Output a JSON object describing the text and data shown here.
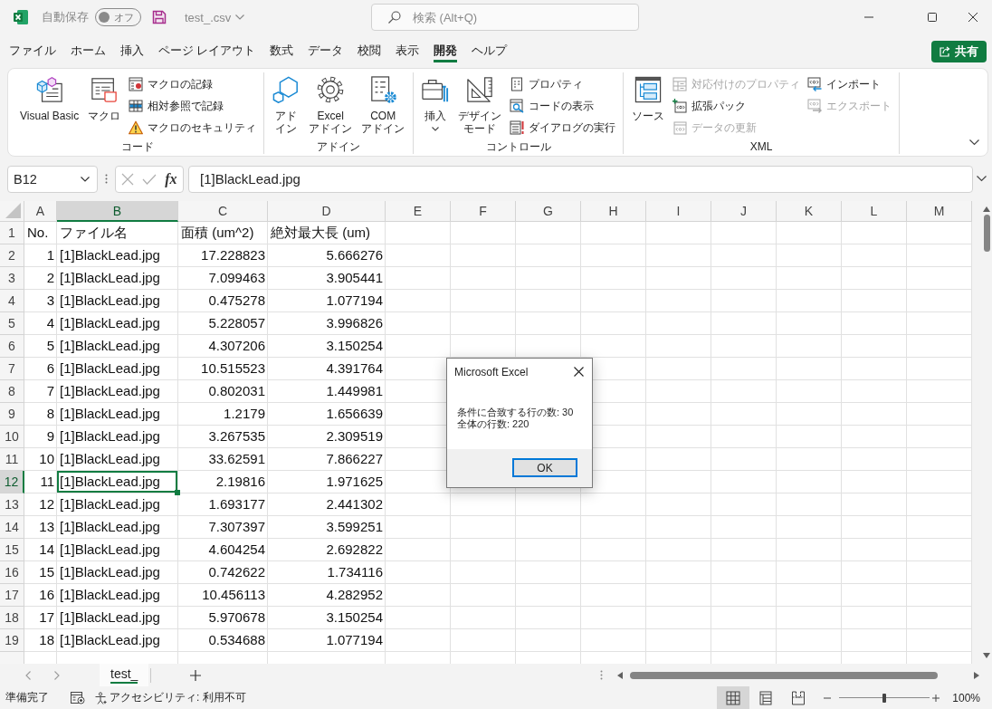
{
  "title_bar": {
    "autosave": {
      "label": "自動保存",
      "state_label": "オフ",
      "on": false
    },
    "file_name": "test_.csv",
    "search": {
      "placeholder": "検索 (Alt+Q)"
    }
  },
  "menu_tabs": [
    {
      "label": "ファイル",
      "selected": false
    },
    {
      "label": "ホーム",
      "selected": false
    },
    {
      "label": "挿入",
      "selected": false
    },
    {
      "label": "ページ レイアウト",
      "selected": false
    },
    {
      "label": "数式",
      "selected": false
    },
    {
      "label": "データ",
      "selected": false
    },
    {
      "label": "校閲",
      "selected": false
    },
    {
      "label": "表示",
      "selected": false
    },
    {
      "label": "開発",
      "selected": true
    },
    {
      "label": "ヘルプ",
      "selected": false
    }
  ],
  "share_button": {
    "label": "共有"
  },
  "ribbon": {
    "groups": [
      {
        "label": "コード",
        "columns": [
          {
            "kind": "large",
            "lines": [
              "Visual Basic"
            ],
            "dropdown": false,
            "disabled": false
          },
          {
            "kind": "large",
            "lines": [
              "マクロ"
            ],
            "dropdown": false,
            "disabled": false
          },
          {
            "kind": "stack",
            "items": [
              {
                "label": "マクロの記録",
                "disabled": false
              },
              {
                "label": "相対参照で記録",
                "disabled": false
              },
              {
                "label": "マクロのセキュリティ",
                "disabled": false
              }
            ]
          }
        ]
      },
      {
        "label": "アドイン",
        "columns": [
          {
            "kind": "large",
            "lines": [
              "アド",
              "イン"
            ],
            "dropdown": false,
            "disabled": false
          },
          {
            "kind": "large",
            "lines": [
              "Excel",
              "アドイン"
            ],
            "dropdown": false,
            "disabled": false
          },
          {
            "kind": "large",
            "lines": [
              "COM",
              "アドイン"
            ],
            "dropdown": false,
            "disabled": false
          }
        ]
      },
      {
        "label": "コントロール",
        "columns": [
          {
            "kind": "large",
            "lines": [
              "挿入"
            ],
            "dropdown": true,
            "disabled": false
          },
          {
            "kind": "large",
            "lines": [
              "デザイン",
              "モード"
            ],
            "dropdown": false,
            "disabled": false
          },
          {
            "kind": "stack",
            "items": [
              {
                "label": "プロパティ",
                "disabled": false
              },
              {
                "label": "コードの表示",
                "disabled": false
              },
              {
                "label": "ダイアログの実行",
                "disabled": false
              }
            ]
          }
        ]
      },
      {
        "label": "XML",
        "columns": [
          {
            "kind": "large",
            "lines": [
              "ソース"
            ],
            "dropdown": false,
            "disabled": false
          },
          {
            "kind": "stack",
            "items": [
              {
                "label": "対応付けのプロパティ",
                "disabled": true
              },
              {
                "label": "拡張パック",
                "disabled": false
              },
              {
                "label": "データの更新",
                "disabled": true
              }
            ]
          },
          {
            "kind": "stack",
            "items": [
              {
                "label": "インポート",
                "disabled": false
              },
              {
                "label": "エクスポート",
                "disabled": true
              }
            ]
          }
        ]
      }
    ]
  },
  "formula_bar": {
    "name_box": "B12",
    "function_label": "fx",
    "formula": "[1]BlackLead.jpg"
  },
  "sheet": {
    "columns": [
      {
        "label": "A",
        "selected": false
      },
      {
        "label": "B",
        "selected": true
      },
      {
        "label": "C",
        "selected": false
      },
      {
        "label": "D",
        "selected": false
      },
      {
        "label": "E",
        "selected": false
      },
      {
        "label": "F",
        "selected": false
      },
      {
        "label": "G",
        "selected": false
      },
      {
        "label": "H",
        "selected": false
      },
      {
        "label": "I",
        "selected": false
      },
      {
        "label": "J",
        "selected": false
      },
      {
        "label": "K",
        "selected": false
      },
      {
        "label": "L",
        "selected": false
      },
      {
        "label": "M",
        "selected": false
      }
    ],
    "rows": [
      {
        "header": "1",
        "selected": false,
        "kind": "header",
        "cells": [
          "No.",
          "ファイル名",
          "面積 (um^2)",
          "絶対最大長 (um)"
        ]
      },
      {
        "header": "2",
        "selected": false,
        "kind": "record",
        "cells": [
          "1",
          "[1]BlackLead.jpg",
          "17.228823",
          "5.666276"
        ]
      },
      {
        "header": "3",
        "selected": false,
        "kind": "record",
        "cells": [
          "2",
          "[1]BlackLead.jpg",
          "7.099463",
          "3.905441"
        ]
      },
      {
        "header": "4",
        "selected": false,
        "kind": "record",
        "cells": [
          "3",
          "[1]BlackLead.jpg",
          "0.475278",
          "1.077194"
        ]
      },
      {
        "header": "5",
        "selected": false,
        "kind": "record",
        "cells": [
          "4",
          "[1]BlackLead.jpg",
          "5.228057",
          "3.996826"
        ]
      },
      {
        "header": "6",
        "selected": false,
        "kind": "record",
        "cells": [
          "5",
          "[1]BlackLead.jpg",
          "4.307206",
          "3.150254"
        ]
      },
      {
        "header": "7",
        "selected": false,
        "kind": "record",
        "cells": [
          "6",
          "[1]BlackLead.jpg",
          "10.515523",
          "4.391764"
        ]
      },
      {
        "header": "8",
        "selected": false,
        "kind": "record",
        "cells": [
          "7",
          "[1]BlackLead.jpg",
          "0.802031",
          "1.449981"
        ]
      },
      {
        "header": "9",
        "selected": false,
        "kind": "record",
        "cells": [
          "8",
          "[1]BlackLead.jpg",
          "1.2179",
          "1.656639"
        ]
      },
      {
        "header": "10",
        "selected": false,
        "kind": "record",
        "cells": [
          "9",
          "[1]BlackLead.jpg",
          "3.267535",
          "2.309519"
        ]
      },
      {
        "header": "11",
        "selected": false,
        "kind": "record",
        "cells": [
          "10",
          "[1]BlackLead.jpg",
          "33.62591",
          "7.866227"
        ]
      },
      {
        "header": "12",
        "selected": true,
        "kind": "record",
        "cells": [
          "11",
          "[1]BlackLead.jpg",
          "2.19816",
          "1.971625"
        ]
      },
      {
        "header": "13",
        "selected": false,
        "kind": "record",
        "cells": [
          "12",
          "[1]BlackLead.jpg",
          "1.693177",
          "2.441302"
        ]
      },
      {
        "header": "14",
        "selected": false,
        "kind": "record",
        "cells": [
          "13",
          "[1]BlackLead.jpg",
          "7.307397",
          "3.599251"
        ]
      },
      {
        "header": "15",
        "selected": false,
        "kind": "record",
        "cells": [
          "14",
          "[1]BlackLead.jpg",
          "4.604254",
          "2.692822"
        ]
      },
      {
        "header": "16",
        "selected": false,
        "kind": "record",
        "cells": [
          "15",
          "[1]BlackLead.jpg",
          "0.742622",
          "1.734116"
        ]
      },
      {
        "header": "17",
        "selected": false,
        "kind": "record",
        "cells": [
          "16",
          "[1]BlackLead.jpg",
          "10.456113",
          "4.282952"
        ]
      },
      {
        "header": "18",
        "selected": false,
        "kind": "record",
        "cells": [
          "17",
          "[1]BlackLead.jpg",
          "5.970678",
          "3.150254"
        ]
      },
      {
        "header": "19",
        "selected": false,
        "kind": "record",
        "cells": [
          "18",
          "[1]BlackLead.jpg",
          "0.534688",
          "1.077194"
        ]
      }
    ]
  },
  "dialog": {
    "title": "Microsoft Excel",
    "lines": [
      "条件に合致する行の数: 30",
      "全体の行数: 220"
    ],
    "button": "OK"
  },
  "sheet_tabs": [
    {
      "label": "test_",
      "selected": true
    }
  ],
  "status_bar": {
    "status": "準備完了",
    "accessibility": "アクセシビリティ: 利用不可",
    "views": [
      {
        "selected": true
      },
      {
        "selected": false
      },
      {
        "selected": false
      }
    ],
    "zoom": {
      "level": 0.5,
      "reading": "100%"
    }
  }
}
